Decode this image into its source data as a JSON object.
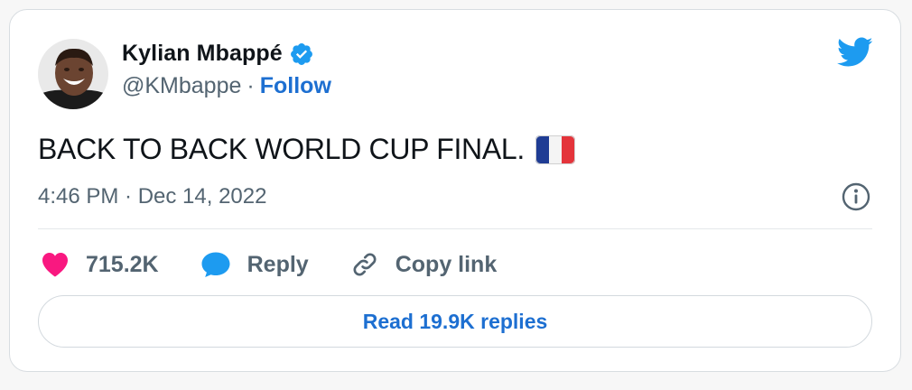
{
  "author": {
    "name": "Kylian Mbappé",
    "handle": "@KMbappe",
    "separator": "·",
    "follow_label": "Follow"
  },
  "tweet": {
    "text": "BACK TO BACK WORLD CUP FINAL.",
    "emoji": "france-flag",
    "timestamp": "4:46 PM · Dec 14, 2022"
  },
  "actions": {
    "likes": "715.2K",
    "reply_label": "Reply",
    "copy_link_label": "Copy link"
  },
  "footer": {
    "read_replies_label": "Read 19.9K replies"
  },
  "colors": {
    "accent": "#1d6fd1",
    "twitter_blue": "#1d9bf0",
    "like": "#f91880",
    "text_primary": "#0f1419",
    "text_secondary": "#536471"
  },
  "icons": {
    "verified": "verified-badge-icon",
    "logo": "twitter-bird-icon",
    "info": "info-icon",
    "like": "heart-icon",
    "reply": "speech-bubble-icon",
    "copy": "link-icon"
  }
}
